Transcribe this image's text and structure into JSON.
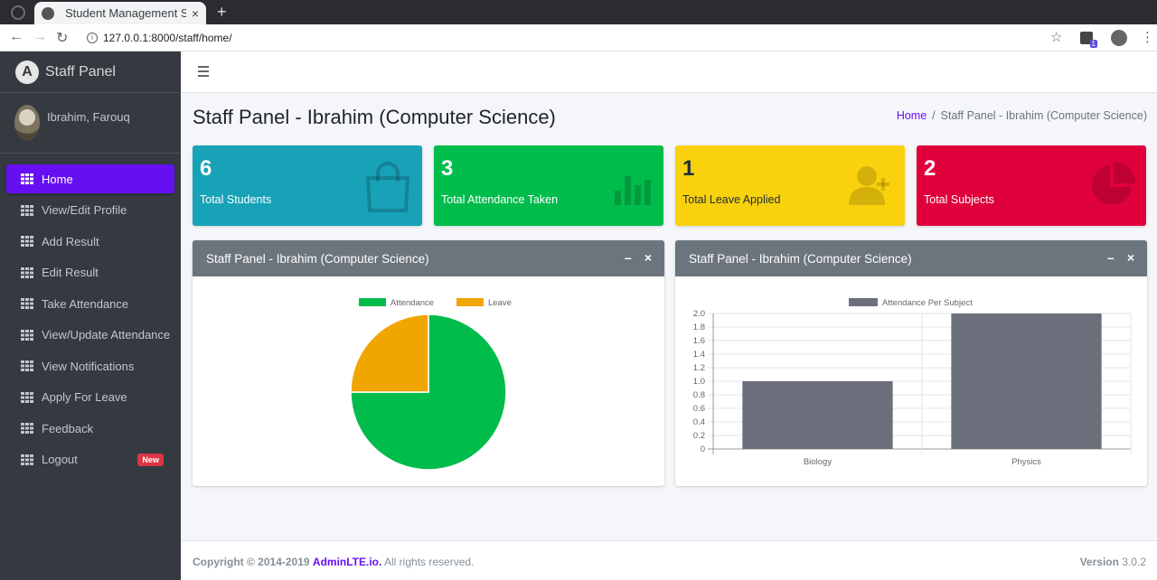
{
  "browser": {
    "tab_title": "Student Management Sys",
    "tab_close": "×",
    "new_tab": "+",
    "url": "127.0.0.1:8000/staff/home/",
    "extension_badge": "1"
  },
  "sidebar": {
    "brand_logo": "A",
    "brand": "Staff Panel",
    "user_name": "Ibrahim, Farouq",
    "items": [
      {
        "label": "Home"
      },
      {
        "label": "View/Edit Profile"
      },
      {
        "label": "Add Result"
      },
      {
        "label": "Edit Result"
      },
      {
        "label": "Take Attendance"
      },
      {
        "label": "View/Update Attendance"
      },
      {
        "label": "View Notifications"
      },
      {
        "label": "Apply For Leave"
      },
      {
        "label": "Feedback"
      },
      {
        "label": "Logout",
        "badge": "New"
      }
    ]
  },
  "header": {
    "title": "Staff Panel - Ibrahim (Computer Science)",
    "breadcrumb_home": "Home",
    "breadcrumb_sep": "/",
    "breadcrumb_current": "Staff Panel - Ibrahim (Computer Science)"
  },
  "stats": [
    {
      "value": "6",
      "label": "Total Students",
      "color": "#17a2b8",
      "icon": "shopping-bag-icon"
    },
    {
      "value": "3",
      "label": "Total Attendance Taken",
      "color": "#00bc4b",
      "icon": "bar-chart-icon"
    },
    {
      "value": "1",
      "label": "Total Leave Applied",
      "color": "#f9d10c",
      "icon": "add-user-icon"
    },
    {
      "value": "2",
      "label": "Total Subjects",
      "color": "#e0003c",
      "icon": "pie-chart-icon"
    }
  ],
  "cards": {
    "left_title": "Staff Panel - Ibrahim (Computer Science)",
    "right_title": "Staff Panel - Ibrahim (Computer Science)",
    "minimize": "–",
    "close": "×"
  },
  "chart_data": [
    {
      "type": "pie",
      "labels": [
        "Attendance",
        "Leave"
      ],
      "values": [
        3,
        1
      ],
      "colors": [
        "#00bc4b",
        "#f0a500"
      ],
      "legend": "top"
    },
    {
      "type": "bar",
      "categories": [
        "Biology",
        "Physics"
      ],
      "series": [
        {
          "name": "Attendance Per Subject",
          "values": [
            1,
            2
          ]
        }
      ],
      "ylim": [
        0,
        2
      ],
      "yticks": [
        "0",
        "0.2",
        "0.4",
        "0.6",
        "0.8",
        "1.0",
        "1.2",
        "1.4",
        "1.6",
        "1.8",
        "2.0"
      ],
      "color": "#6c707c",
      "grid": true,
      "legend": "top"
    }
  ],
  "footer": {
    "copyright": "Copyright © 2014-2019",
    "link": "AdminLTE.io.",
    "rights": "All rights reserved.",
    "version_label": "Version",
    "version": "3.0.2"
  }
}
